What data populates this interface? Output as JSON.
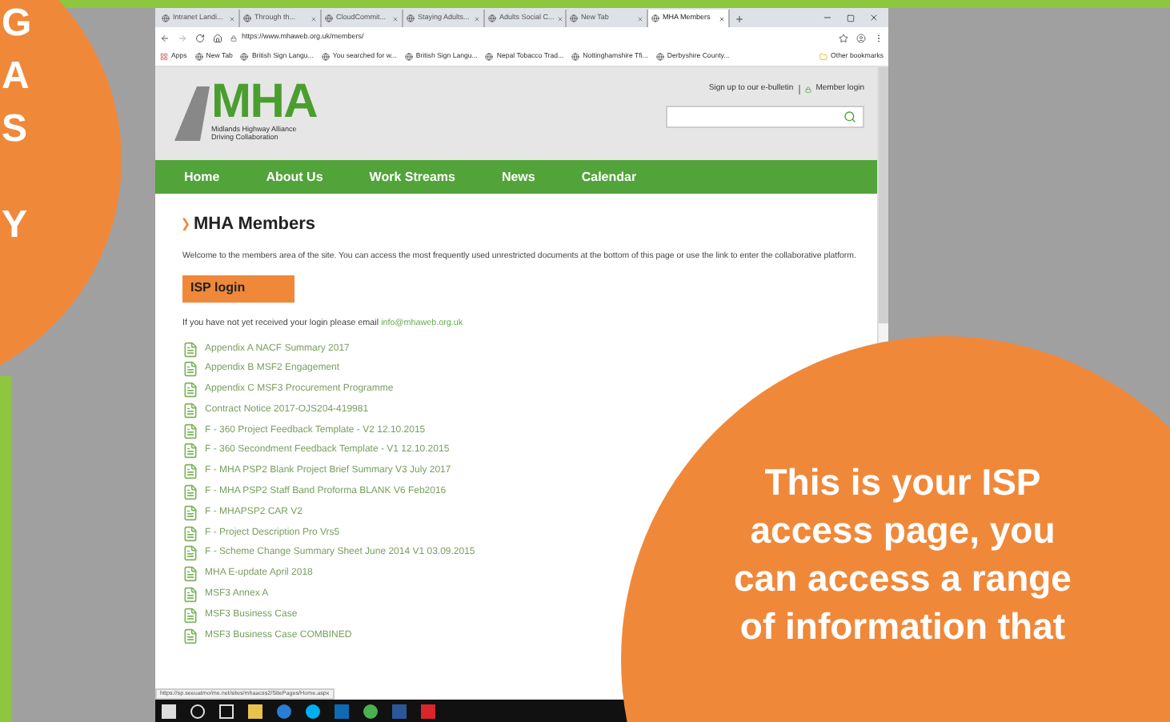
{
  "left_badge": {
    "lines": [
      "G",
      "A",
      "S",
      "Y"
    ]
  },
  "browser": {
    "tabs": [
      {
        "title": "Intranet Landi...",
        "selected": false
      },
      {
        "title": "Through th...",
        "selected": false
      },
      {
        "title": "CloudCommit...",
        "selected": false
      },
      {
        "title": "Staying Adults...",
        "selected": false
      },
      {
        "title": "Adults Social C...",
        "selected": false
      },
      {
        "title": "New Tab",
        "selected": false
      },
      {
        "title": "MHA Members",
        "selected": true
      }
    ],
    "address": "https://www.mhaweb.org.uk/members/",
    "bookmarks": [
      "Apps",
      "New Tab",
      "British Sign Langu...",
      "You searched for w...",
      "British Sign Langu...",
      "Nepal Tobacco Trad...",
      "Nottinghamshire Tfi...",
      "Derbyshire County..."
    ],
    "other_bookmarks": "Other bookmarks"
  },
  "site": {
    "logo": {
      "text": "MHA",
      "tagline_1": "Midlands Highway Alliance",
      "tagline_2": "Driving Collaboration"
    },
    "header_links": [
      "Sign up to our e-bulletin",
      "Member login"
    ],
    "nav": [
      "Home",
      "About Us",
      "Work Streams",
      "News",
      "Calendar"
    ],
    "heading": "MHA Members",
    "intro": "Welcome to the members area of the site. You can access the most frequently used unrestricted documents at the bottom of this page or use the link to enter the collaborative platform.",
    "login_button": "ISP login",
    "email_prompt": "If you have not yet received your login please email",
    "email": "info@mhaweb.org.uk",
    "documents": [
      "Appendix A NACF Summary 2017",
      "Appendix B MSF2 Engagement",
      "Appendix C MSF3 Procurement Programme",
      "Contract Notice 2017-OJS204-419981",
      "F - 360 Project Feedback Template - V2 12.10.2015",
      "F - 360 Secondment Feedback Template - V1 12.10.2015",
      "F - MHA PSP2 Blank Project Brief Summary V3 July 2017",
      "F - MHA PSP2 Staff Band Proforma BLANK V6 Feb2016",
      "F - MHAPSP2 CAR V2",
      "F - Project Description Pro Vrs5",
      "F - Scheme Change Summary Sheet June 2014 V1 03.09.2015",
      "MHA E-update April 2018",
      "MSF3 Annex A",
      "MSF3 Business Case",
      "MSF3 Business Case COMBINED"
    ]
  },
  "status_url": "https://sp.seeuatmo/me.net/sites/mhaacss2/SitePages/Home.aspx",
  "callout": {
    "lines": [
      "This is your ISP",
      "access page, you",
      "can access a range",
      "of information that"
    ]
  }
}
